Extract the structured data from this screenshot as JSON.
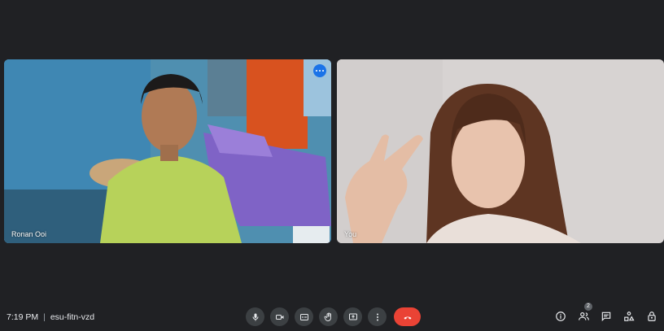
{
  "participants": [
    {
      "name": "Ronan Ooi",
      "active_speaker": true
    },
    {
      "name": "You",
      "active_speaker": false
    }
  ],
  "meeting": {
    "time": "7:19 PM",
    "separator": "|",
    "code": "esu-fitn-vzd"
  },
  "controls": [
    "microphone-icon",
    "camera-icon",
    "captions-icon",
    "raise-hand-icon",
    "present-screen-icon",
    "more-options-icon",
    "end-call-icon"
  ],
  "right_panel": {
    "people_count": "2"
  },
  "colors": {
    "background": "#202124",
    "active_border": "#8ab4f8",
    "end_call": "#ea4335",
    "control_bg": "#3c4043"
  }
}
